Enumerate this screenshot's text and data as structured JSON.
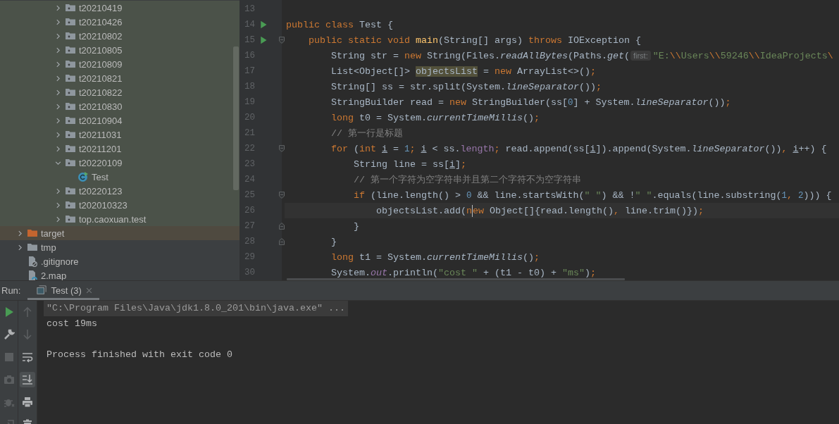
{
  "project_tree": {
    "package_items": [
      {
        "label": "t20210419",
        "kind": "package",
        "expanded": false,
        "color": "#4b5249"
      },
      {
        "label": "t20210426",
        "kind": "package",
        "expanded": false,
        "color": "#4b5249"
      },
      {
        "label": "t20210802",
        "kind": "package",
        "expanded": false,
        "color": "#4b5249"
      },
      {
        "label": "t20210805",
        "kind": "package",
        "expanded": false,
        "color": "#4b5249"
      },
      {
        "label": "t20210809",
        "kind": "package",
        "expanded": false,
        "color": "#4b5249"
      },
      {
        "label": "t20210821",
        "kind": "package",
        "expanded": false,
        "color": "#4b5249"
      },
      {
        "label": "t20210822",
        "kind": "package",
        "expanded": false,
        "color": "#4b5249"
      },
      {
        "label": "t20210830",
        "kind": "package",
        "expanded": false,
        "color": "#4b5249"
      },
      {
        "label": "t20210904",
        "kind": "package",
        "expanded": false,
        "color": "#4b5249"
      },
      {
        "label": "t20211031",
        "kind": "package",
        "expanded": false,
        "color": "#4b5249"
      },
      {
        "label": "t20211201",
        "kind": "package",
        "expanded": false,
        "color": "#4b5249"
      },
      {
        "label": "t20220109",
        "kind": "package",
        "expanded": true,
        "color": "#4b5249",
        "children": [
          {
            "label": "Test",
            "kind": "class",
            "color": "#4b5249"
          }
        ]
      },
      {
        "label": "t20220123",
        "kind": "package",
        "expanded": false,
        "color": "#4b5249"
      },
      {
        "label": "t202010323",
        "kind": "package",
        "expanded": false,
        "color": "#4b5249"
      },
      {
        "label": "top.caoxuan.test",
        "kind": "package",
        "expanded": false,
        "color": "#4b5249"
      }
    ],
    "root_items": [
      {
        "label": "target",
        "kind": "excluded-folder",
        "expanded": false,
        "color": "#4f4a40"
      },
      {
        "label": "tmp",
        "kind": "folder",
        "expanded": false
      },
      {
        "label": ".gitignore",
        "kind": "ignore-file"
      },
      {
        "label": "2.map",
        "kind": "file"
      }
    ]
  },
  "editor": {
    "lines": [
      {
        "number": "13"
      },
      {
        "number": "14",
        "runnable": true,
        "tokens": [
          {
            "kind": "keyword",
            "text": "public class "
          },
          {
            "kind": "plain",
            "text": "Test {"
          }
        ],
        "children": [
          {
            "number": "15",
            "runnable": true,
            "fold_open": true,
            "tokens": [
              {
                "kind": "keyword",
                "text": "public static void "
              },
              {
                "kind": "declaration",
                "text": "main"
              },
              {
                "kind": "plain",
                "text": "(String[] args) "
              },
              {
                "kind": "keyword",
                "text": "throws "
              },
              {
                "kind": "plain",
                "text": "IOException {"
              }
            ],
            "children": [
              {
                "number": "16",
                "tokens": [
                  {
                    "kind": "plain",
                    "text": "String str = "
                  },
                  {
                    "kind": "keyword",
                    "text": "new "
                  },
                  {
                    "kind": "plain",
                    "text": "String(Files."
                  },
                  {
                    "kind": "static",
                    "text": "readAllBytes"
                  },
                  {
                    "kind": "plain",
                    "text": "(Paths."
                  },
                  {
                    "kind": "static",
                    "text": "get"
                  },
                  {
                    "kind": "plain",
                    "text": "("
                  },
                  {
                    "kind": "hint",
                    "text": "first:"
                  },
                  {
                    "kind": "string",
                    "text": "\"E:"
                  },
                  {
                    "kind": "escape",
                    "text": "\\\\"
                  },
                  {
                    "kind": "string",
                    "text": "Users"
                  },
                  {
                    "kind": "escape",
                    "text": "\\\\"
                  },
                  {
                    "kind": "string",
                    "text": "59246"
                  },
                  {
                    "kind": "escape",
                    "text": "\\\\"
                  },
                  {
                    "kind": "string",
                    "text": "IdeaProjects"
                  },
                  {
                    "kind": "escape",
                    "text": "\\"
                  }
                ]
              },
              {
                "number": "17",
                "tokens": [
                  {
                    "kind": "plain",
                    "text": "List<Object[]> "
                  },
                  {
                    "kind": "usage",
                    "text": "objectsList"
                  },
                  {
                    "kind": "plain",
                    "text": " = "
                  },
                  {
                    "kind": "keyword",
                    "text": "new "
                  },
                  {
                    "kind": "plain",
                    "text": "ArrayList<>()"
                  },
                  {
                    "kind": "keyword",
                    "text": ";"
                  }
                ]
              },
              {
                "number": "18",
                "tokens": [
                  {
                    "kind": "plain",
                    "text": "String[] ss = str.split(System."
                  },
                  {
                    "kind": "static",
                    "text": "lineSeparator"
                  },
                  {
                    "kind": "plain",
                    "text": "())"
                  },
                  {
                    "kind": "keyword",
                    "text": ";"
                  }
                ]
              },
              {
                "number": "19",
                "tokens": [
                  {
                    "kind": "plain",
                    "text": "StringBuilder read = "
                  },
                  {
                    "kind": "keyword",
                    "text": "new "
                  },
                  {
                    "kind": "plain",
                    "text": "StringBuilder(ss["
                  },
                  {
                    "kind": "number",
                    "text": "0"
                  },
                  {
                    "kind": "plain",
                    "text": "] + System."
                  },
                  {
                    "kind": "static",
                    "text": "lineSeparator"
                  },
                  {
                    "kind": "plain",
                    "text": "())"
                  },
                  {
                    "kind": "keyword",
                    "text": ";"
                  }
                ]
              },
              {
                "number": "20",
                "tokens": [
                  {
                    "kind": "keyword",
                    "text": "long "
                  },
                  {
                    "kind": "plain",
                    "text": "t0 = System."
                  },
                  {
                    "kind": "static",
                    "text": "currentTimeMillis"
                  },
                  {
                    "kind": "plain",
                    "text": "()"
                  },
                  {
                    "kind": "keyword",
                    "text": ";"
                  }
                ]
              },
              {
                "number": "21",
                "tokens": [
                  {
                    "kind": "comment",
                    "text": "// 第一行是标题"
                  }
                ]
              },
              {
                "number": "22",
                "fold_open": true,
                "tokens": [
                  {
                    "kind": "keyword",
                    "text": "for "
                  },
                  {
                    "kind": "plain",
                    "text": "("
                  },
                  {
                    "kind": "keyword",
                    "text": "int "
                  },
                  {
                    "kind": "reassigned",
                    "text": "i"
                  },
                  {
                    "kind": "plain",
                    "text": " = "
                  },
                  {
                    "kind": "number",
                    "text": "1"
                  },
                  {
                    "kind": "keyword",
                    "text": "; "
                  },
                  {
                    "kind": "reassigned",
                    "text": "i"
                  },
                  {
                    "kind": "plain",
                    "text": " < ss."
                  },
                  {
                    "kind": "field",
                    "text": "length"
                  },
                  {
                    "kind": "keyword",
                    "text": "; "
                  },
                  {
                    "kind": "plain",
                    "text": "read.append(ss["
                  },
                  {
                    "kind": "reassigned",
                    "text": "i"
                  },
                  {
                    "kind": "plain",
                    "text": "]).append(System."
                  },
                  {
                    "kind": "static",
                    "text": "lineSeparator"
                  },
                  {
                    "kind": "plain",
                    "text": "())"
                  },
                  {
                    "kind": "keyword",
                    "text": ", "
                  },
                  {
                    "kind": "reassigned",
                    "text": "i"
                  },
                  {
                    "kind": "plain",
                    "text": "++) {"
                  }
                ],
                "children": [
                  {
                    "number": "23",
                    "tokens": [
                      {
                        "kind": "plain",
                        "text": "String line = ss["
                      },
                      {
                        "kind": "reassigned",
                        "text": "i"
                      },
                      {
                        "kind": "plain",
                        "text": "]"
                      },
                      {
                        "kind": "keyword",
                        "text": ";"
                      }
                    ]
                  },
                  {
                    "number": "24",
                    "tokens": [
                      {
                        "kind": "comment",
                        "text": "// 第一个字符为空字符串并且第二个字符不为空字符串"
                      }
                    ]
                  },
                  {
                    "number": "25",
                    "fold_open": true,
                    "tokens": [
                      {
                        "kind": "keyword",
                        "text": "if "
                      },
                      {
                        "kind": "plain",
                        "text": "(line.length() > "
                      },
                      {
                        "kind": "number",
                        "text": "0"
                      },
                      {
                        "kind": "plain",
                        "text": " && line.startsWith("
                      },
                      {
                        "kind": "string",
                        "text": "\" \""
                      },
                      {
                        "kind": "plain",
                        "text": ") && !"
                      },
                      {
                        "kind": "string",
                        "text": "\" \""
                      },
                      {
                        "kind": "plain",
                        "text": ".equals(line.substring("
                      },
                      {
                        "kind": "number",
                        "text": "1"
                      },
                      {
                        "kind": "keyword",
                        "text": ", "
                      },
                      {
                        "kind": "number",
                        "text": "2"
                      },
                      {
                        "kind": "plain",
                        "text": "))) {"
                      }
                    ],
                    "children": [
                      {
                        "number": "26",
                        "current": true,
                        "tokens": [
                          {
                            "kind": "plain",
                            "text": "objectsList.add("
                          },
                          {
                            "kind": "keyword",
                            "text": "n"
                          },
                          {
                            "kind": "caret"
                          },
                          {
                            "kind": "keyword",
                            "text": "ew "
                          },
                          {
                            "kind": "plain",
                            "text": "Object[]{read.length()"
                          },
                          {
                            "kind": "keyword",
                            "text": ", "
                          },
                          {
                            "kind": "plain",
                            "text": "line.trim()})"
                          },
                          {
                            "kind": "keyword",
                            "text": ";"
                          }
                        ]
                      }
                    ]
                  },
                  {
                    "number": "27",
                    "fold_close": true,
                    "tokens": [
                      {
                        "kind": "plain",
                        "text": "}"
                      }
                    ]
                  }
                ]
              },
              {
                "number": "28",
                "fold_close": true,
                "tokens": [
                  {
                    "kind": "plain",
                    "text": "}"
                  }
                ]
              },
              {
                "number": "29",
                "tokens": [
                  {
                    "kind": "keyword",
                    "text": "long "
                  },
                  {
                    "kind": "plain",
                    "text": "t1 = System."
                  },
                  {
                    "kind": "static",
                    "text": "currentTimeMillis"
                  },
                  {
                    "kind": "plain",
                    "text": "()"
                  },
                  {
                    "kind": "keyword",
                    "text": ";"
                  }
                ]
              },
              {
                "number": "30",
                "tokens": [
                  {
                    "kind": "plain",
                    "text": "System."
                  },
                  {
                    "kind": "static-field",
                    "text": "out"
                  },
                  {
                    "kind": "plain",
                    "text": ".println("
                  },
                  {
                    "kind": "string",
                    "text": "\"cost \""
                  },
                  {
                    "kind": "plain",
                    "text": " + (t1 - t0) + "
                  },
                  {
                    "kind": "string",
                    "text": "\"ms\""
                  },
                  {
                    "kind": "plain",
                    "text": ")"
                  },
                  {
                    "kind": "keyword",
                    "text": ";"
                  }
                ]
              }
            ]
          }
        ]
      }
    ]
  },
  "run_panel": {
    "label": "Run:",
    "tabs": [
      {
        "label": "Test (3)",
        "selected": true
      }
    ],
    "toolbar_left": [
      {
        "kind": "run",
        "disabled": false
      },
      {
        "kind": "wrench",
        "disabled": false
      },
      {
        "kind": "stop",
        "disabled": true
      },
      {
        "kind": "camera",
        "disabled": true
      },
      {
        "kind": "bug",
        "disabled": true
      },
      {
        "kind": "exit",
        "disabled": true
      }
    ],
    "toolbar_right": [
      {
        "kind": "up",
        "disabled": true,
        "on": false
      },
      {
        "kind": "down",
        "disabled": true,
        "on": false
      },
      {
        "kind": "wrap",
        "disabled": false,
        "on": false
      },
      {
        "kind": "scroll-end",
        "disabled": false,
        "on": true
      },
      {
        "kind": "print",
        "disabled": false,
        "on": false
      },
      {
        "kind": "trash",
        "disabled": false,
        "on": false
      }
    ],
    "console": [
      {
        "kind": "command",
        "text": "\"C:\\Program Files\\Java\\jdk1.8.0_201\\bin\\java.exe\" ..."
      },
      {
        "kind": "output",
        "text": "cost 19ms"
      },
      {
        "kind": "status",
        "text": "Process finished with exit code 0"
      }
    ]
  }
}
